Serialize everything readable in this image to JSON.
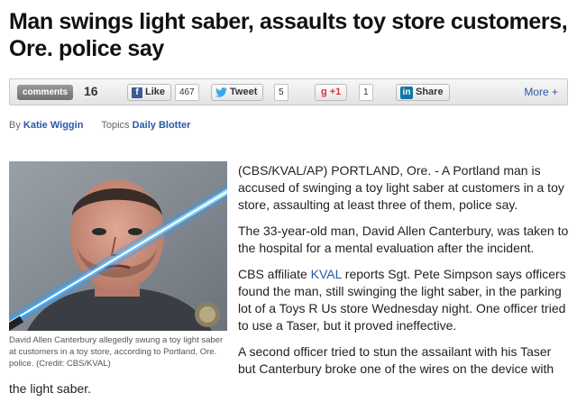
{
  "headline": "Man swings light saber, assaults toy store customers, Ore. police say",
  "sharebar": {
    "comments_label": "comments",
    "comments_count": "16",
    "like_label": "Like",
    "like_count": "467",
    "tweet_label": "Tweet",
    "tweet_count": "5",
    "gplus_label": "+1",
    "gplus_count": "1",
    "linkedin_label": "Share",
    "more_label": "More +"
  },
  "byline": {
    "by_label": "By",
    "author": "Katie Wiggin",
    "topics_label": "Topics",
    "topic": "Daily Blotter"
  },
  "photo": {
    "caption": "David Allen Canterbury allegedly swung a toy light saber at customers in a toy store, according to Portland, Ore. police. (Credit: CBS/KVAL)"
  },
  "article": {
    "p1": "(CBS/KVAL/AP) PORTLAND, Ore. - A Portland man is accused of swinging a toy light saber at customers in a toy store, assaulting at least three of them, police say.",
    "p2": "The 33-year-old man, David Allen Canterbury, was taken to the hospital for a mental evaluation after the incident.",
    "p3_before": "CBS affiliate ",
    "p3_link": "KVAL",
    "p3_after": " reports Sgt. Pete Simpson says officers found the man, still swinging the light saber, in the parking lot of a Toys R Us store Wednesday night. One officer tried to use a Taser, but it proved ineffective.",
    "p4": "A second officer tried to stun the assailant with his Taser but Canterbury broke one of the wires on the device with",
    "p4_tail": "the light saber."
  },
  "colors": {
    "link": "#2a58a8",
    "saber": "#3ab8ff",
    "facebook": "#3b5998",
    "linkedin": "#0e76a8"
  }
}
